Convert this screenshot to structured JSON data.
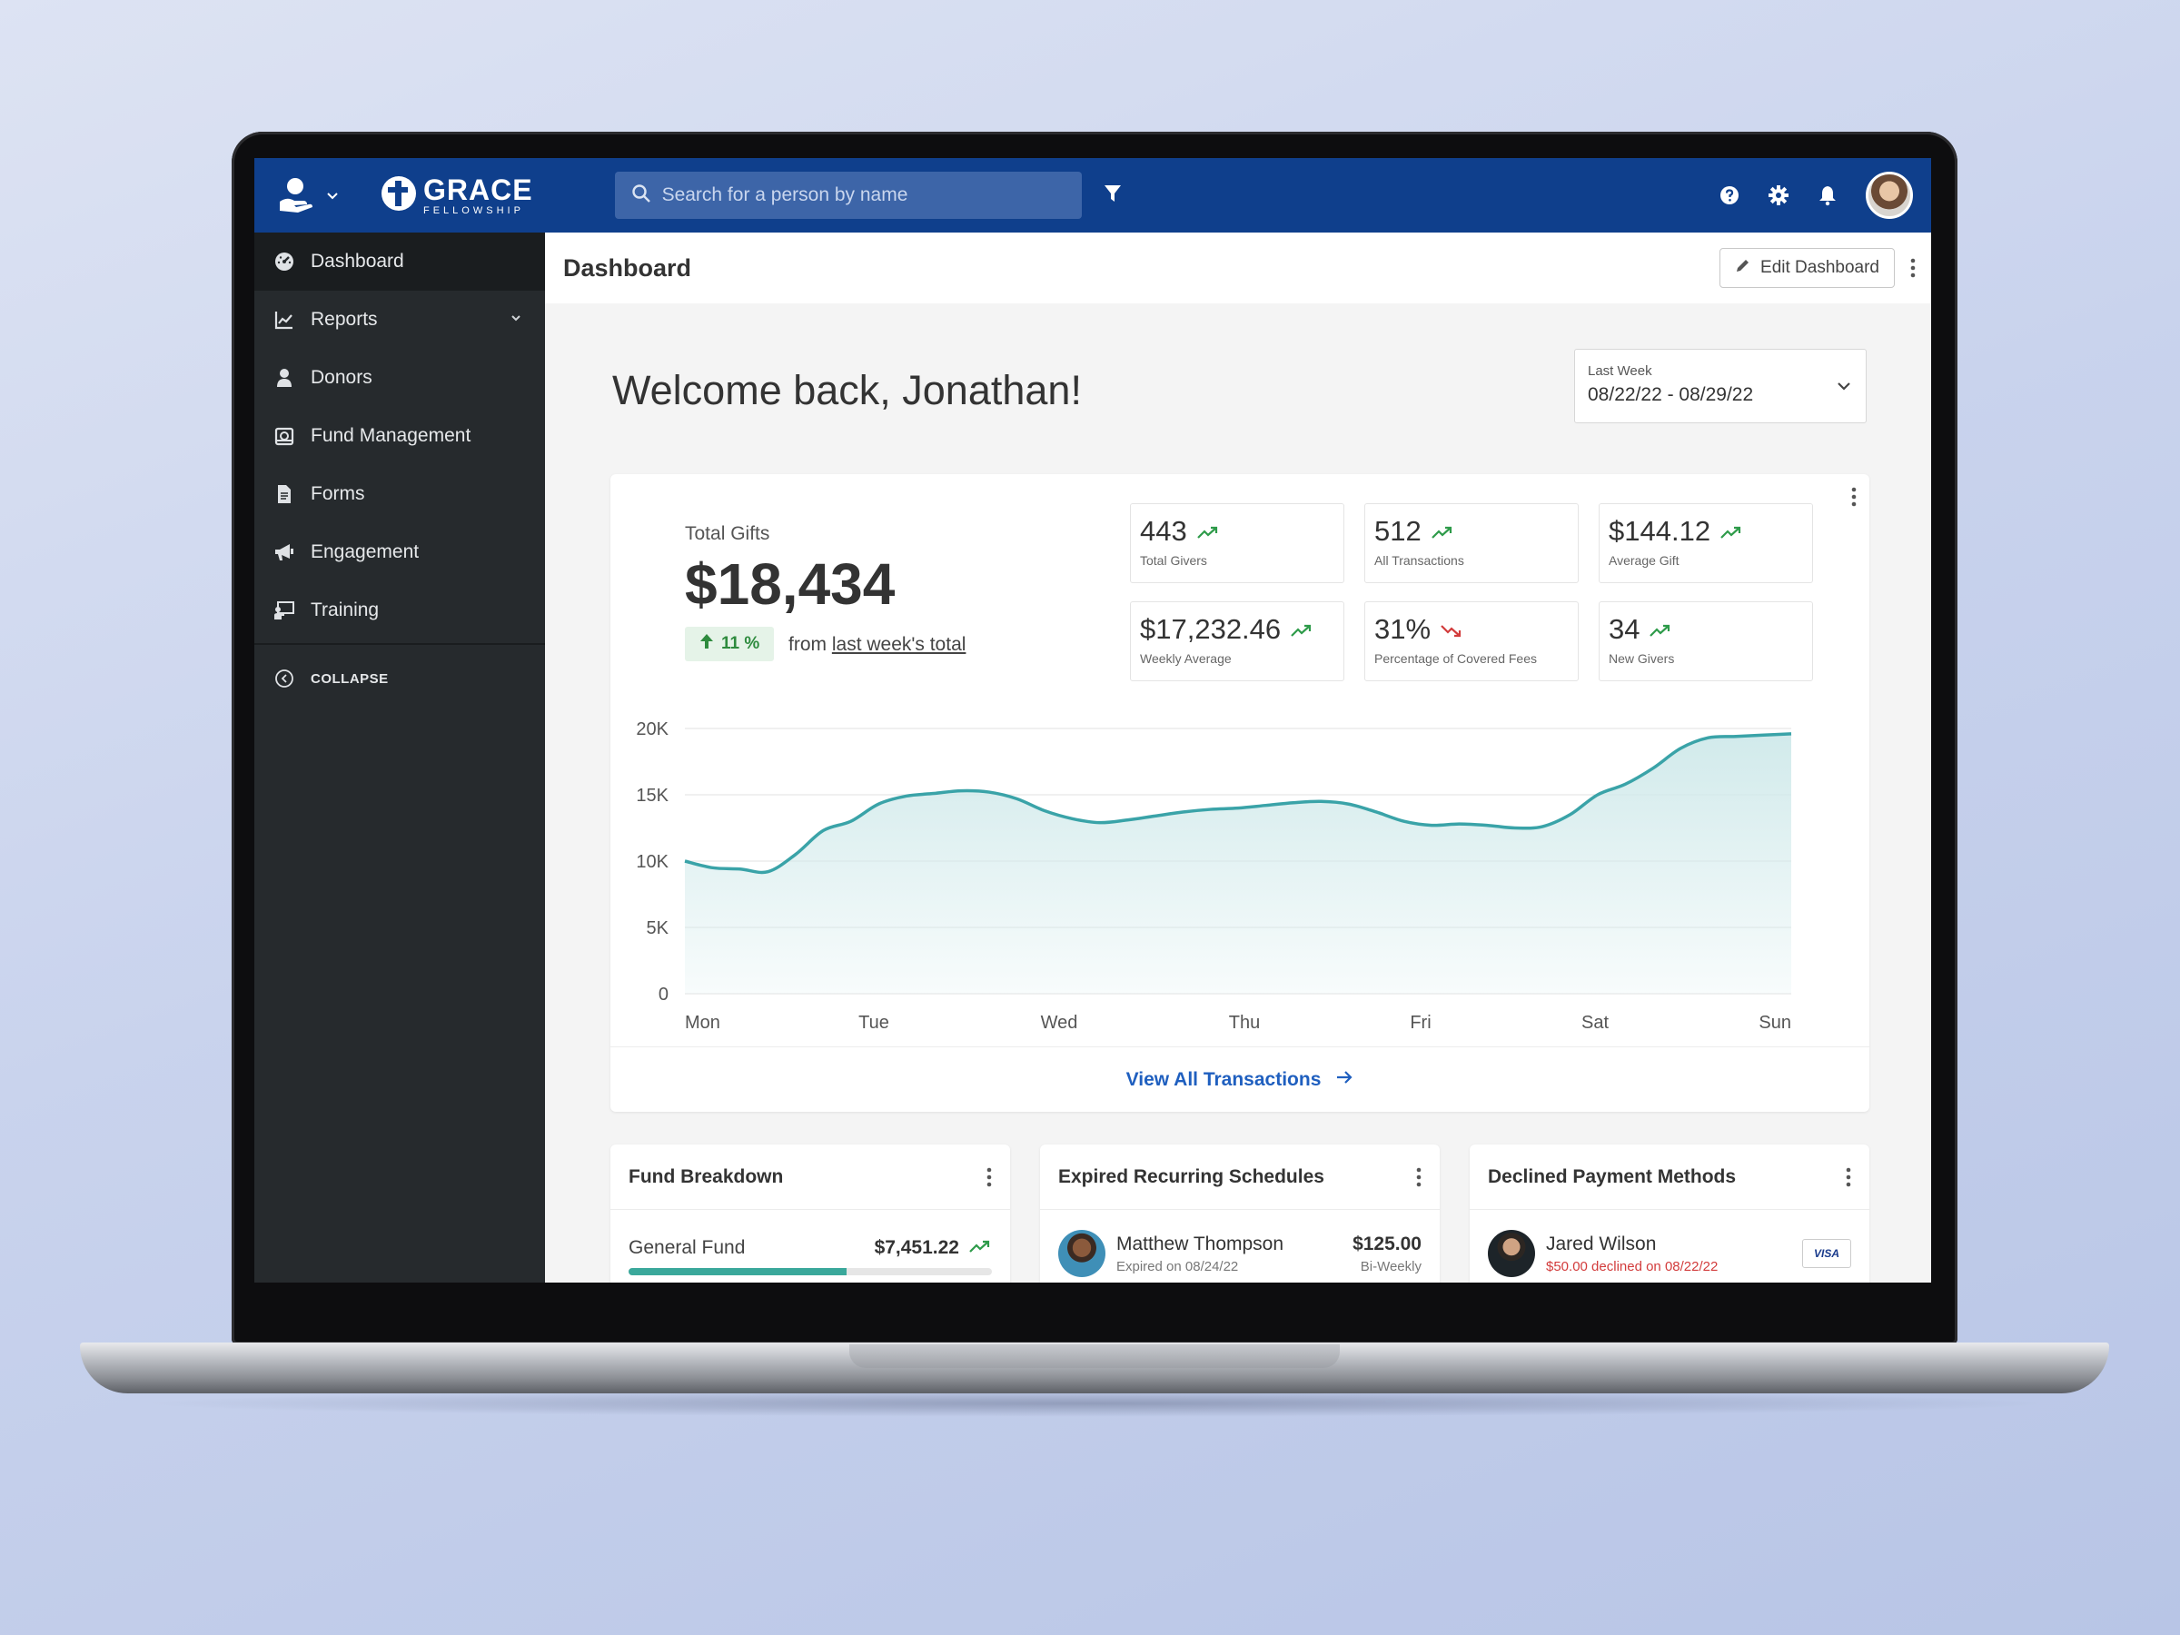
{
  "topbar": {
    "logo_main": "GRACE",
    "logo_sub": "FELLOWSHIP",
    "search_placeholder": "Search for a person by name"
  },
  "sidebar": {
    "items": [
      {
        "label": "Dashboard",
        "icon": "gauge-icon",
        "active": true
      },
      {
        "label": "Reports",
        "icon": "chart-line-icon",
        "has_chevron": true
      },
      {
        "label": "Donors",
        "icon": "person-icon"
      },
      {
        "label": "Fund Management",
        "icon": "fund-box-icon"
      },
      {
        "label": "Forms",
        "icon": "document-icon"
      },
      {
        "label": "Engagement",
        "icon": "megaphone-icon"
      },
      {
        "label": "Training",
        "icon": "presentation-icon"
      }
    ],
    "collapse_label": "COLLAPSE"
  },
  "header": {
    "title": "Dashboard",
    "edit_label": "Edit Dashboard"
  },
  "welcome": "Welcome back, Jonathan!",
  "date_range": {
    "label": "Last Week",
    "value": "08/22/22 - 08/29/22"
  },
  "gifts": {
    "total_label": "Total Gifts",
    "total_value": "$18,434",
    "change_value": "11 %",
    "change_prefix": "from",
    "change_link": "last week's total",
    "stats": [
      {
        "value": "443",
        "label": "Total Givers",
        "trend": "up"
      },
      {
        "value": "512",
        "label": "All Transactions",
        "trend": "up"
      },
      {
        "value": "$144.12",
        "label": "Average Gift",
        "trend": "up"
      },
      {
        "value": "$17,232.46",
        "label": "Weekly Average",
        "trend": "up"
      },
      {
        "value": "31%",
        "label": "Percentage of Covered Fees",
        "trend": "down"
      },
      {
        "value": "34",
        "label": "New Givers",
        "trend": "up"
      }
    ],
    "view_all_label": "View All Transactions"
  },
  "chart_data": {
    "type": "area",
    "categories": [
      "Mon",
      "Tue",
      "Wed",
      "Thu",
      "Fri",
      "Sat",
      "Sun"
    ],
    "y_ticks": [
      "20K",
      "15K",
      "10K",
      "5K",
      "0"
    ],
    "ylim": [
      0,
      20000
    ],
    "x": [
      0,
      0.15,
      0.3,
      0.45,
      0.6,
      0.75,
      0.9,
      1.05,
      1.2,
      1.35,
      1.5,
      1.65,
      1.8,
      1.95,
      2.1,
      2.25,
      2.4,
      2.55,
      2.7,
      2.85,
      3.0,
      3.15,
      3.3,
      3.45,
      3.6,
      3.75,
      3.9,
      4.05,
      4.2,
      4.35,
      4.5,
      4.65,
      4.8,
      4.95,
      5.1,
      5.25,
      5.4,
      5.55,
      5.7,
      5.85,
      6.0
    ],
    "values": [
      10000,
      9500,
      9400,
      9200,
      10500,
      12300,
      13000,
      14300,
      14900,
      15100,
      15300,
      15200,
      14700,
      13800,
      13200,
      12900,
      13100,
      13400,
      13700,
      13900,
      14000,
      14200,
      14400,
      14500,
      14300,
      13700,
      13000,
      12700,
      12800,
      12700,
      12500,
      12600,
      13500,
      15000,
      15800,
      17000,
      18500,
      19300,
      19400,
      19500,
      19600
    ],
    "colors": {
      "line": "#3aa3a8",
      "fill": "#cfe9ea"
    }
  },
  "fund_breakdown": {
    "title": "Fund Breakdown",
    "rows": [
      {
        "name": "General Fund",
        "amount": "$7,451.22",
        "progress": 0.6
      }
    ]
  },
  "expired": {
    "title": "Expired Recurring Schedules",
    "rows": [
      {
        "name": "Matthew Thompson",
        "sub": "Expired on 08/24/22",
        "amount": "$125.00",
        "frequency": "Bi-Weekly"
      }
    ]
  },
  "declined": {
    "title": "Declined Payment Methods",
    "rows": [
      {
        "name": "Jared Wilson",
        "sub": "$50.00 declined on 08/22/22",
        "card": "VISA"
      }
    ]
  },
  "colors": {
    "topbar": "#0f3f8c",
    "sidebar": "#262a2d",
    "accent_link": "#1f5fbf",
    "trend_up": "#2e9b4a",
    "trend_down": "#d23b3b"
  }
}
